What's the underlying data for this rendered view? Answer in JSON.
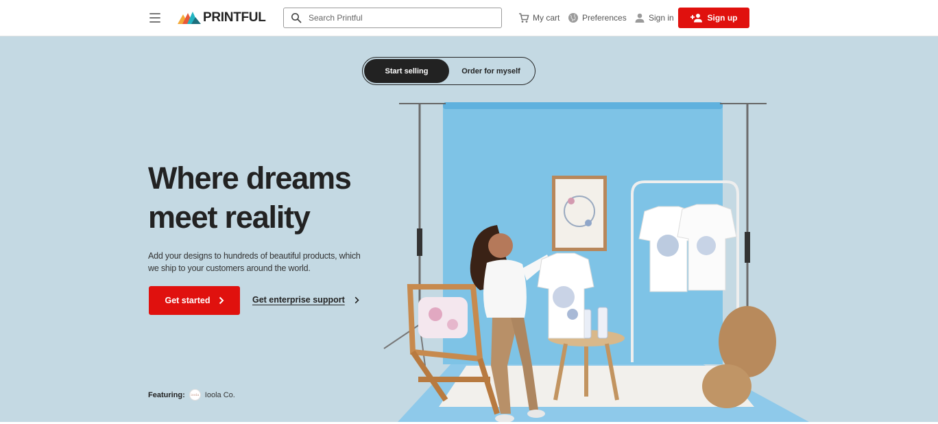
{
  "header": {
    "logo_text": "PRINTFUL",
    "search_placeholder": "Search Printful",
    "cart_label": "My cart",
    "preferences_label": "Preferences",
    "signin_label": "Sign in",
    "signup_label": "Sign up"
  },
  "hero": {
    "toggle": {
      "active_label": "Start selling",
      "inactive_label": "Order for myself"
    },
    "headline": "Where dreams meet reality",
    "subtext": "Add your designs to hundreds of beautiful products, which we ship to your customers around the world.",
    "cta_label": "Get started",
    "enterprise_label": "Get enterprise support",
    "featuring_label": "Featuring:",
    "featuring_brand": "Ioola Co."
  },
  "colors": {
    "brand_red": "#e0110e",
    "hero_bg": "#c4d9e3",
    "backdrop_blue": "#7ec3e6",
    "text_dark": "#222222"
  },
  "icons": [
    "menu-icon",
    "search-icon",
    "cart-icon",
    "globe-icon",
    "user-icon",
    "add-user-icon",
    "chevron-right-icon"
  ]
}
